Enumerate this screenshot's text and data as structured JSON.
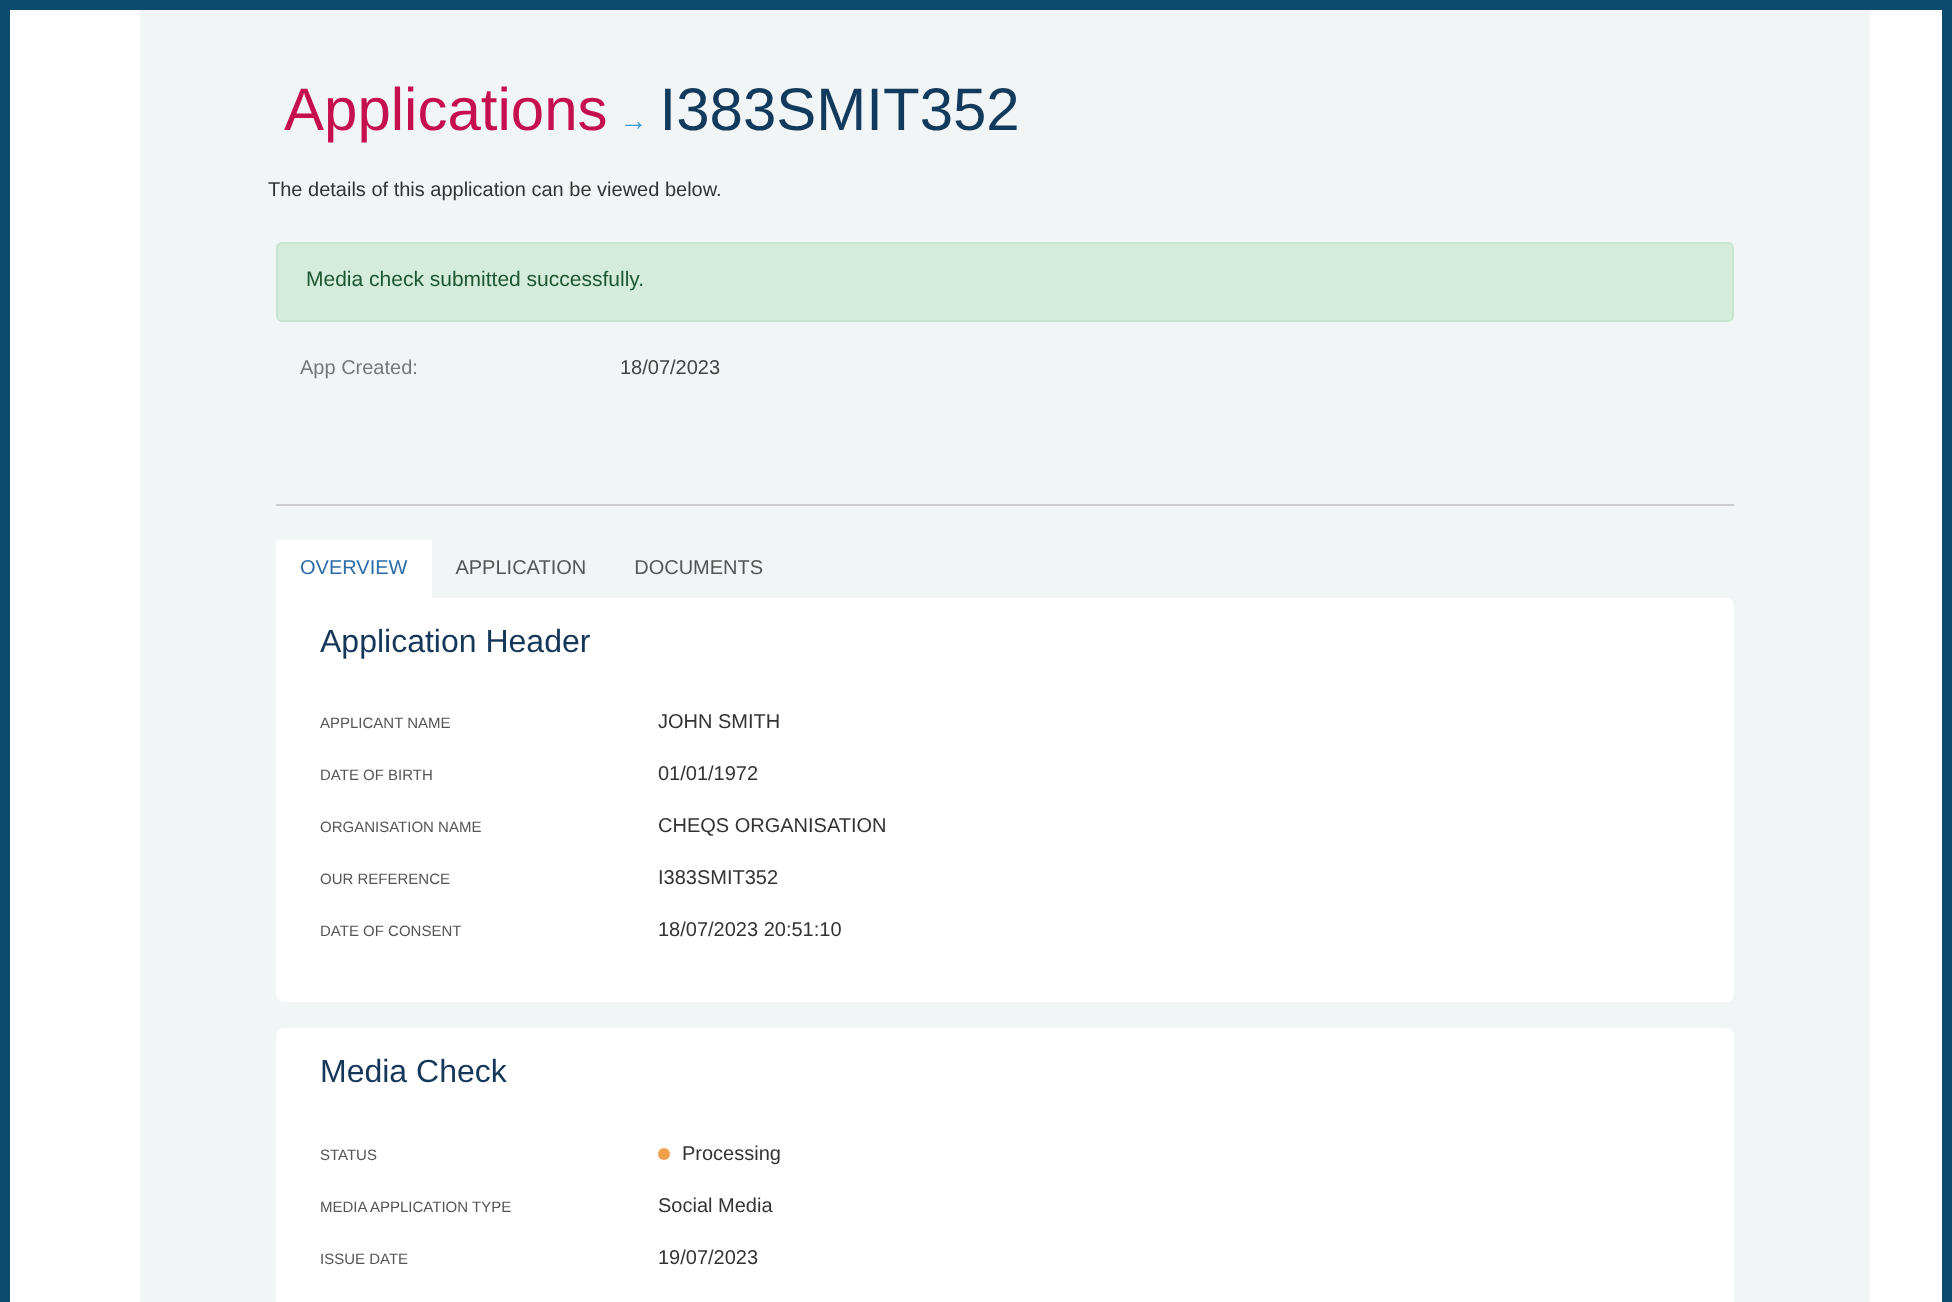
{
  "title": {
    "section": "Applications",
    "arrow": "→",
    "reference": "I383SMIT352"
  },
  "intro": "The details of this application can be viewed below.",
  "alert": "Media check submitted successfully.",
  "app_created": {
    "label": "App Created:",
    "value": "18/07/2023"
  },
  "tabs": [
    {
      "label": "OVERVIEW",
      "selected": true
    },
    {
      "label": "APPLICATION",
      "selected": false
    },
    {
      "label": "DOCUMENTS",
      "selected": false
    }
  ],
  "sections": [
    {
      "title": "Application Header",
      "rows": [
        {
          "label": "APPLICANT NAME",
          "value": "JOHN SMITH"
        },
        {
          "label": "DATE OF BIRTH",
          "value": "01/01/1972"
        },
        {
          "label": "ORGANISATION NAME",
          "value": "CHEQS ORGANISATION"
        },
        {
          "label": "OUR REFERENCE",
          "value": "I383SMIT352"
        },
        {
          "label": "DATE OF CONSENT",
          "value": "18/07/2023 20:51:10"
        }
      ]
    },
    {
      "title": "Media Check",
      "rows": [
        {
          "label": "STATUS",
          "value": "Processing",
          "kind": "status",
          "color": "#f0a04b"
        },
        {
          "label": "MEDIA APPLICATION TYPE",
          "value": "Social Media"
        },
        {
          "label": "ISSUE DATE",
          "value": "19/07/2023"
        }
      ]
    }
  ]
}
